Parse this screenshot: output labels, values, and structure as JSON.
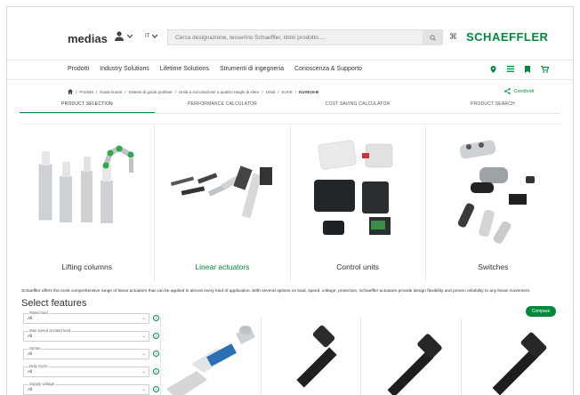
{
  "header": {
    "logo": "medias",
    "lang": "IT",
    "search_placeholder": "Cerca designazione, tesserino Schaeffler, titolo prodotto....",
    "brand": "SCHAEFFLER"
  },
  "nav": {
    "items": [
      "Prodotti",
      "Industry Solutions",
      "Lifetime Solutions",
      "Strumenti di ingegneria",
      "Conoscenza & Supporto"
    ]
  },
  "breadcrumb": {
    "items": [
      "Prodotti",
      "Guide lineari",
      "Sistemi di guide profilate",
      "Unità a ricircolazione a quattro ranghi di sfere",
      "Unità",
      "KUVE",
      "KUVE15-B"
    ]
  },
  "share_label": "Condividi",
  "tabs": [
    "PRODUCT SELECTION",
    "PERFORMANCE CALCULATOR",
    "COST SAVING CALCULATOR",
    "PRODUCT SEARCH"
  ],
  "categories": [
    "Lifting columns",
    "Linear actuators",
    "Control units",
    "Switches"
  ],
  "intro_text": "Schaeffler offers the most comprehensive range of linear actuators that can be applied in almost every kind of application. With several options on load, speed, voltage, protection, Schaeffler actuators provide design flexibility and proven reliability to any linear movement.",
  "select_features": "Select features",
  "compare_label": "Compare",
  "filters": [
    {
      "label": "Rated load",
      "value": "All"
    },
    {
      "label": "Max speed at rated load",
      "value": "All"
    },
    {
      "label": "Stroke",
      "value": "All"
    },
    {
      "label": "Duty Cycle",
      "value": "All"
    },
    {
      "label": "Supply voltage",
      "value": "All"
    }
  ],
  "colors": {
    "accent": "#00893d"
  }
}
